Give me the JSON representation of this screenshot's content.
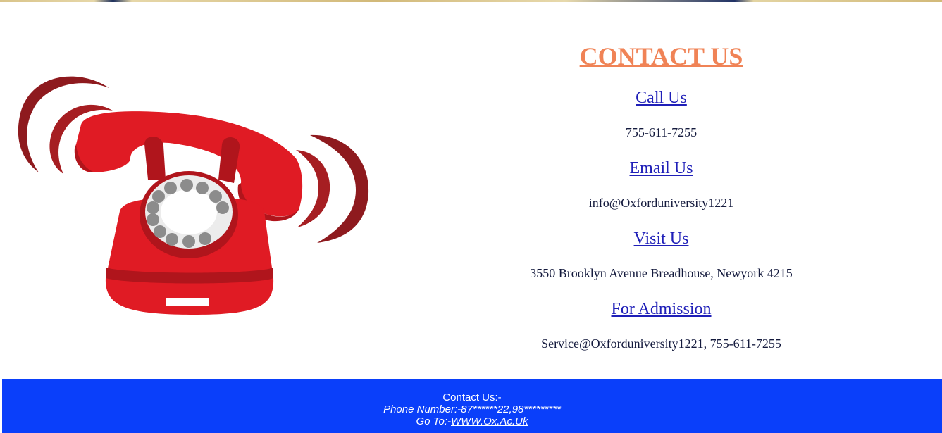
{
  "contact": {
    "title": "CONTACT US",
    "sections": [
      {
        "heading": "Call Us",
        "value": "755-611-7255"
      },
      {
        "heading": "Email Us",
        "value": "info@Oxforduniversity1221"
      },
      {
        "heading": "Visit Us",
        "value": "3550 Brooklyn Avenue Breadhouse, Newyork 4215"
      },
      {
        "heading": "For Admission",
        "value": "Service@Oxforduniversity1221, 755-611-7255"
      }
    ]
  },
  "footer": {
    "heading": "Contact Us:-",
    "phone": "Phone Number:-87******22,98*********",
    "goto_prefix": "Go To:-",
    "goto_link": "WWW.Ox.Ac.Uk"
  },
  "colors": {
    "title": "#f08356",
    "link": "#1f1fb8",
    "footer_bg": "#0a3ffa",
    "phone_red": "#e01b24"
  },
  "icons": {
    "illustration": "red-telephone-ringing"
  }
}
